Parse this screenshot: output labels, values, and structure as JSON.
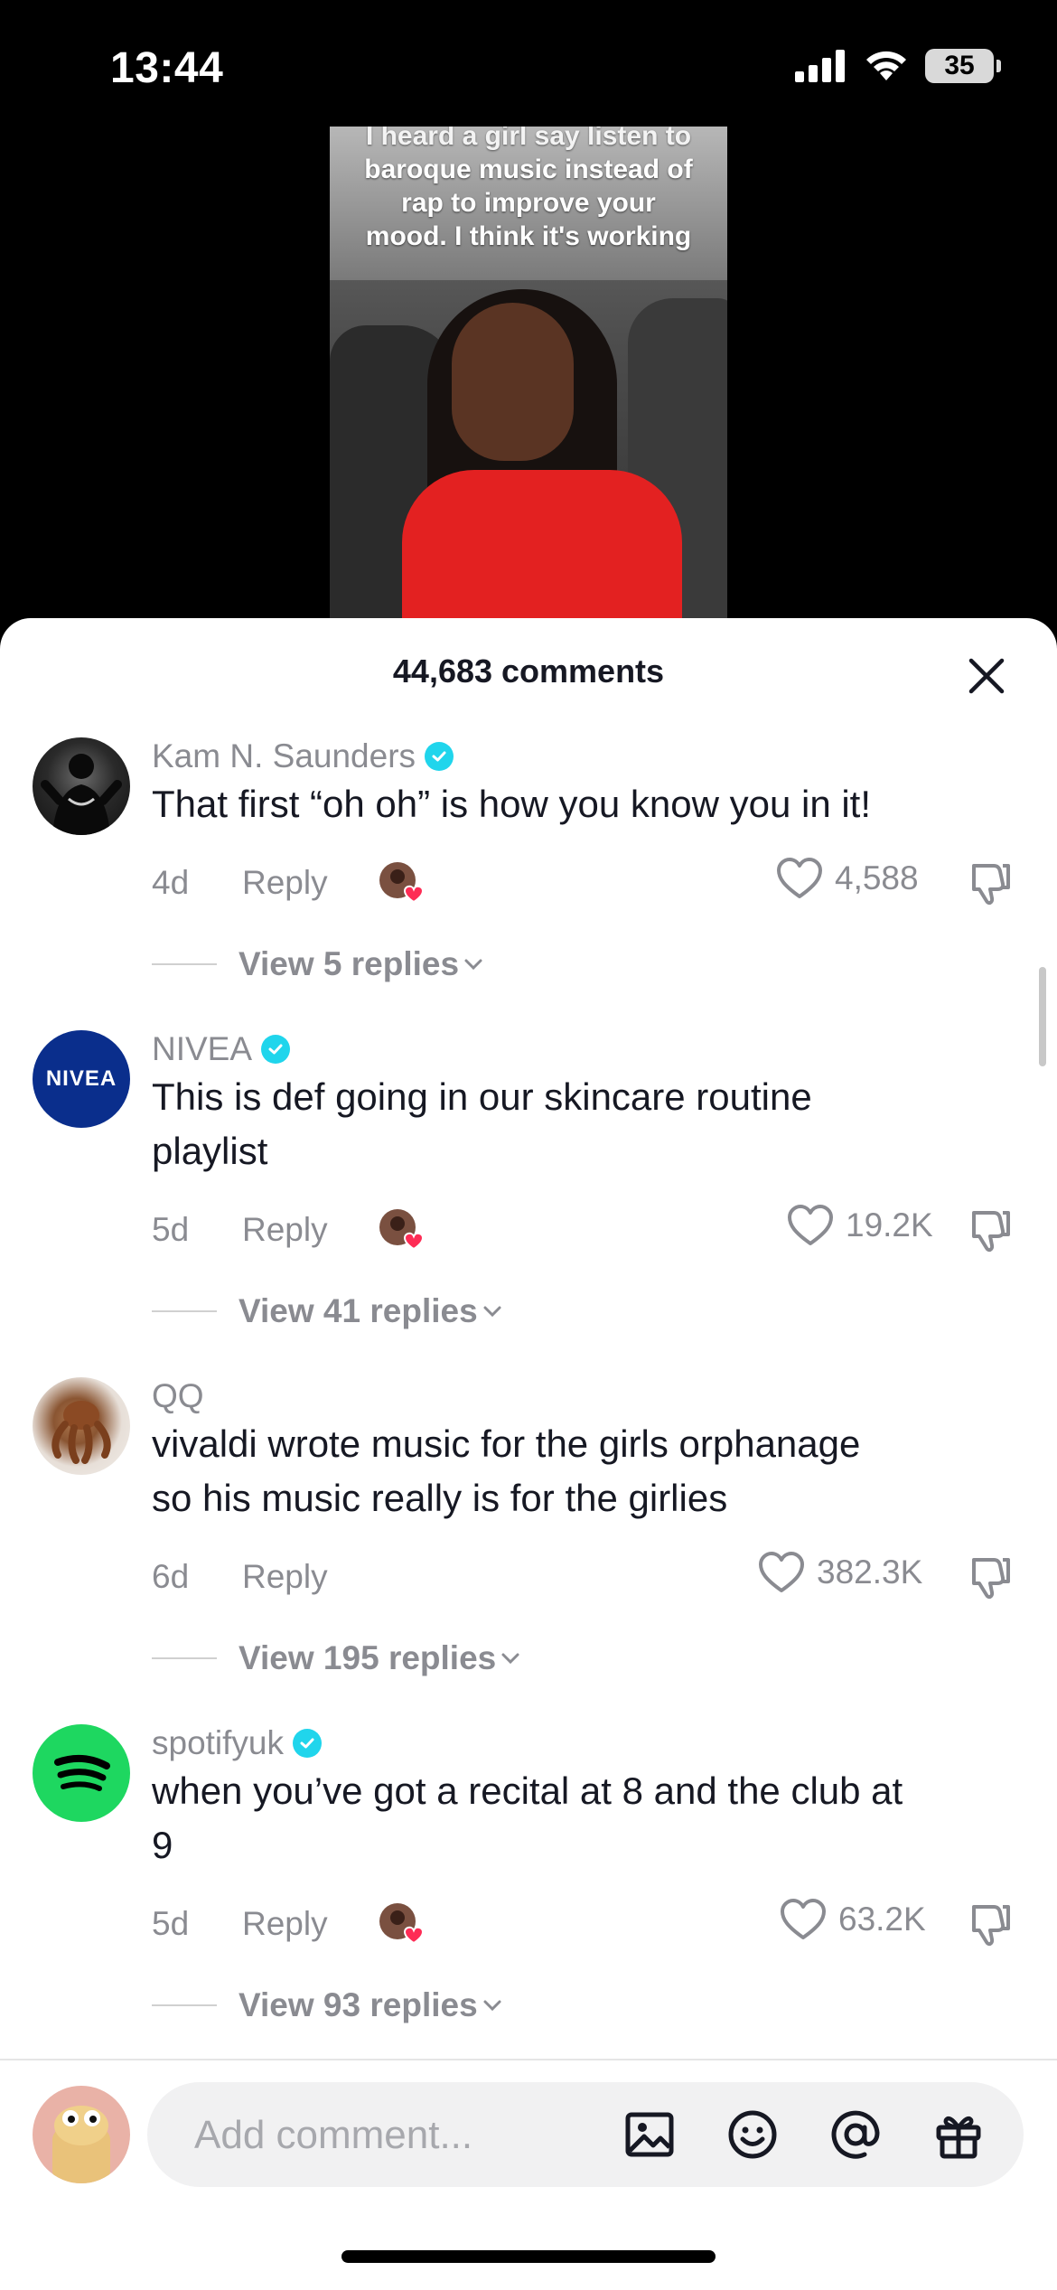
{
  "status_bar": {
    "time": "13:44",
    "battery": "35"
  },
  "video": {
    "caption_lines": [
      "I heard a girl say listen to",
      "baroque music instead of",
      "rap to improve your",
      "mood. I think it's working"
    ]
  },
  "comments_sheet": {
    "title": "44,683 comments",
    "reply_label": "Reply",
    "comments": [
      {
        "username": "Kam N. Saunders",
        "verified": true,
        "lines": [
          "That first “oh oh” is how you know you in it!"
        ],
        "age": "4d",
        "creator_liked": true,
        "likes": "4,588",
        "view_replies": "View 5 replies"
      },
      {
        "username": "NIVEA",
        "verified": true,
        "lines": [
          "This is def going in our skincare routine",
          "playlist"
        ],
        "age": "5d",
        "creator_liked": true,
        "likes": "19.2K",
        "view_replies": "View 41 replies"
      },
      {
        "username": "QQ",
        "verified": false,
        "lines": [
          "vivaldi wrote music for the girls orphanage",
          "so his music really is for the girlies"
        ],
        "age": "6d",
        "creator_liked": false,
        "likes": "382.3K",
        "view_replies": "View 195 replies"
      },
      {
        "username": "spotifyuk",
        "verified": true,
        "lines": [
          "when you’ve got a recital at 8 and the club at",
          "9"
        ],
        "age": "5d",
        "creator_liked": true,
        "likes": "63.2K",
        "view_replies": "View 93 replies"
      }
    ],
    "nivea_logo_text": "NIVEA"
  },
  "composer": {
    "placeholder": "Add comment..."
  },
  "colors": {
    "verified": "#20d5ec",
    "nivea_blue": "#0a2e8c",
    "spotify_green": "#1ed760",
    "heart_red": "#fe2c55"
  }
}
